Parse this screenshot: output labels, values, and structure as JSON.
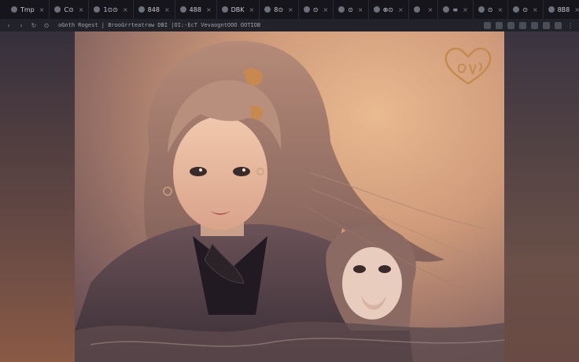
{
  "tabs": [
    {
      "label": "Tmp",
      "icon": "page-icon"
    },
    {
      "label": "C⊙",
      "icon": "page-icon"
    },
    {
      "label": "1⊙⊙",
      "icon": "page-icon"
    },
    {
      "label": "848",
      "icon": "page-icon"
    },
    {
      "label": "488",
      "icon": "page-icon"
    },
    {
      "label": "DBK",
      "icon": "page-icon"
    },
    {
      "label": "8⊙",
      "icon": "page-icon"
    },
    {
      "label": "⊙",
      "icon": "page-icon"
    },
    {
      "label": "⊙",
      "icon": "page-icon"
    },
    {
      "label": "⊗⊙",
      "icon": "page-icon"
    },
    {
      "label": "",
      "icon": "arrow-icon"
    },
    {
      "label": "≡",
      "icon": "page-icon"
    },
    {
      "label": "⊙",
      "icon": "page-icon"
    },
    {
      "label": "⊙",
      "icon": "page-icon"
    },
    {
      "label": "8B8",
      "icon": "page-icon"
    }
  ],
  "toolbar": {
    "url": "oGnth Rogest | BrooGrrteatraw DBI |OI:-EcT VevaogntOOO OOTIOB"
  },
  "colors": {
    "tabbar_bg": "#15151b",
    "toolbar_bg": "#22222a",
    "accent_warm": "#e9b990"
  }
}
